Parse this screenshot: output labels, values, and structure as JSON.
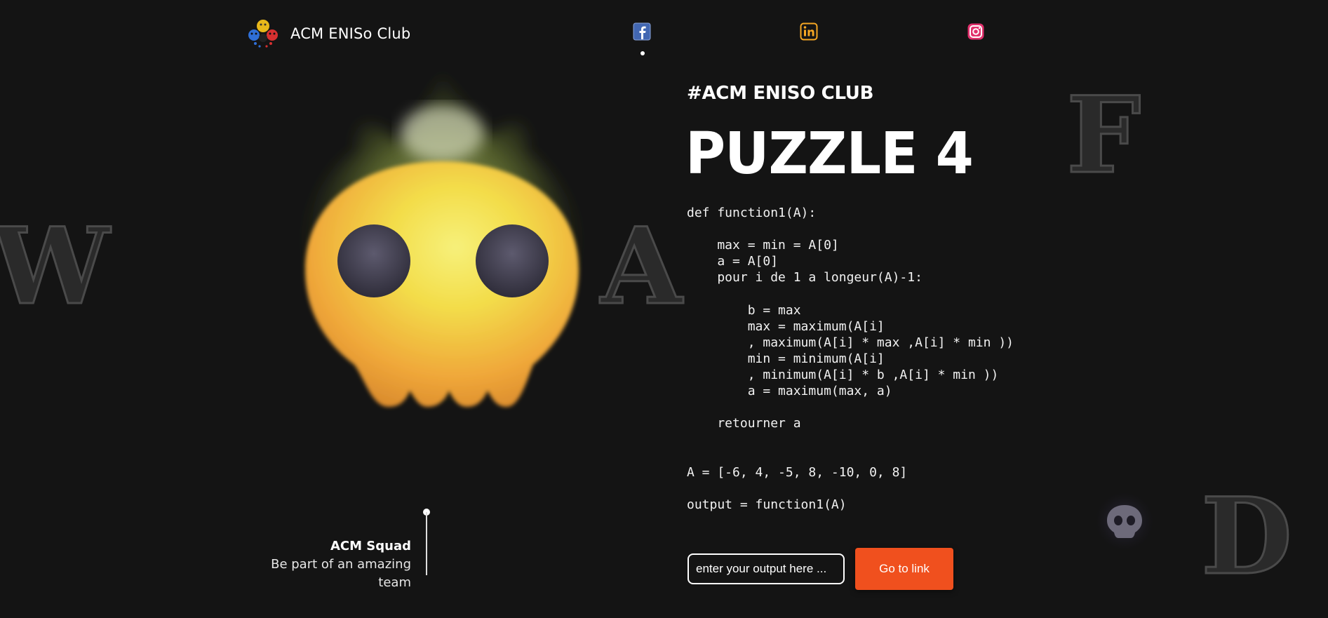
{
  "header": {
    "brand_name": "ACM ENISo Club",
    "social": [
      {
        "name": "facebook",
        "icon": "facebook-icon",
        "color": "#4267B2"
      },
      {
        "name": "linkedin",
        "icon": "linkedin-icon",
        "color": "#f5a623"
      },
      {
        "name": "instagram",
        "icon": "instagram-icon",
        "color": "#e1306c"
      }
    ]
  },
  "background_letters": [
    "W",
    "A",
    "F",
    "D"
  ],
  "hero": {
    "squad_title": "ACM Squad",
    "squad_text": "Be part of an amazing team"
  },
  "puzzle": {
    "tag": "#ACM ENISO CLUB",
    "title": "PUZZLE 4",
    "code": "def function1(A):\n\n    max = min = A[0]\n    a = A[0]\n    pour i de 1 a longeur(A)-1:\n\n        b = max\n        max = maximum(A[i]\n        , maximum(A[i] * max ,A[i] * min ))\n        min = minimum(A[i]\n        , minimum(A[i] * b ,A[i] * min ))\n        a = maximum(max, a)\n\n    retourner a\n\n\nA = [-6, 4, -5, 8, -10, 0, 8]\n\noutput = function1(A)",
    "input_placeholder": "enter your output here ...",
    "input_value": "",
    "button_label": "Go to link"
  },
  "colors": {
    "background": "#141414",
    "accent": "#f0501e",
    "text": "#ffffff"
  }
}
